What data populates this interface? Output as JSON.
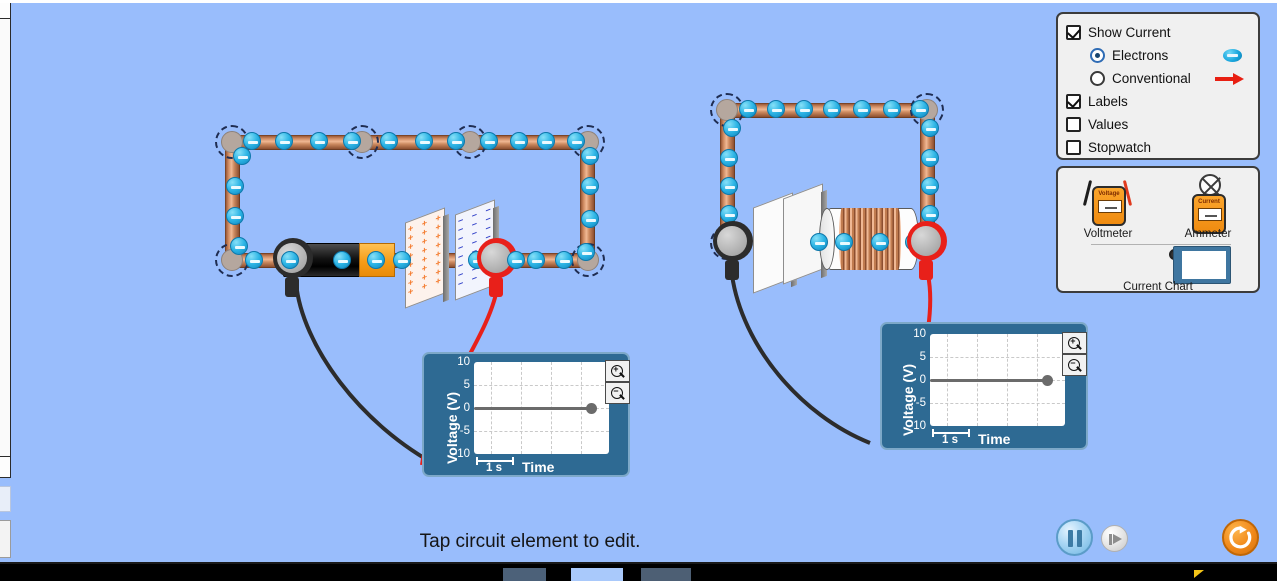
{
  "app": {
    "background_color": "#99bdfc",
    "status_text": "Tap circuit element to edit."
  },
  "control_panel": {
    "options": [
      {
        "id": "show-current",
        "label": "Show Current",
        "type": "checkbox",
        "checked": true
      },
      {
        "id": "electrons",
        "label": "Electrons",
        "type": "radio",
        "selected": true,
        "symbol": "electron-icon"
      },
      {
        "id": "conventional",
        "label": "Conventional",
        "type": "radio",
        "selected": false,
        "symbol": "red-arrow-icon"
      },
      {
        "id": "labels",
        "label": "Labels",
        "type": "checkbox",
        "checked": true
      },
      {
        "id": "values",
        "label": "Values",
        "type": "checkbox",
        "checked": false
      },
      {
        "id": "stopwatch",
        "label": "Stopwatch",
        "type": "checkbox",
        "checked": false
      }
    ]
  },
  "tool_panel": {
    "tools": [
      {
        "id": "voltmeter",
        "label": "Voltmeter",
        "screen_title": "Voltage"
      },
      {
        "id": "ammeter",
        "label": "Ammeter",
        "screen_title": "Current"
      },
      {
        "id": "current-chart",
        "label": "Current Chart"
      }
    ]
  },
  "charts": [
    {
      "id": "left-voltage-chart",
      "ylabel": "Voltage (V)",
      "xlabel": "Time",
      "scale_label": "1 s",
      "yticks": [
        "10",
        "5",
        "0",
        "-5",
        "-10"
      ],
      "zoom_in": "+",
      "zoom_out": "−"
    },
    {
      "id": "right-voltage-chart",
      "ylabel": "Voltage (V)",
      "xlabel": "Time",
      "scale_label": "1 s",
      "yticks": [
        "10",
        "5",
        "0",
        "-5",
        "-10"
      ],
      "zoom_in": "+",
      "zoom_out": "−"
    }
  ],
  "chart_data": [
    {
      "type": "line",
      "id": "left-voltage-chart",
      "title": "",
      "xlabel": "Time",
      "ylabel": "Voltage (V)",
      "ylim": [
        -10,
        10
      ],
      "yticks": [
        10,
        5,
        0,
        -5,
        -10
      ],
      "xtick_scale": "1 s",
      "grid": true,
      "legend": "none",
      "series": [
        {
          "name": "Voltage",
          "x": [
            0,
            1,
            2,
            3,
            4
          ],
          "values": [
            0,
            0,
            0,
            0,
            0
          ],
          "marker_at_end": true
        }
      ]
    },
    {
      "type": "line",
      "id": "right-voltage-chart",
      "title": "",
      "xlabel": "Time",
      "ylabel": "Voltage (V)",
      "ylim": [
        -10,
        10
      ],
      "yticks": [
        10,
        5,
        0,
        -5,
        -10
      ],
      "xtick_scale": "1 s",
      "grid": true,
      "legend": "none",
      "series": [
        {
          "name": "Voltage",
          "x": [
            0,
            1,
            2,
            3,
            4
          ],
          "values": [
            0,
            0,
            0,
            0,
            0
          ],
          "marker_at_end": true
        }
      ]
    }
  ],
  "circuits": {
    "left": {
      "elements": [
        "battery",
        "charged-capacitor",
        "black-voltmeter-probe",
        "red-voltmeter-probe"
      ]
    },
    "right": {
      "elements": [
        "uncharged-capacitor",
        "inductor",
        "black-voltmeter-probe",
        "red-voltmeter-probe"
      ]
    }
  },
  "transport": {
    "pause_label": "",
    "step_label": "",
    "reset_label": ""
  }
}
